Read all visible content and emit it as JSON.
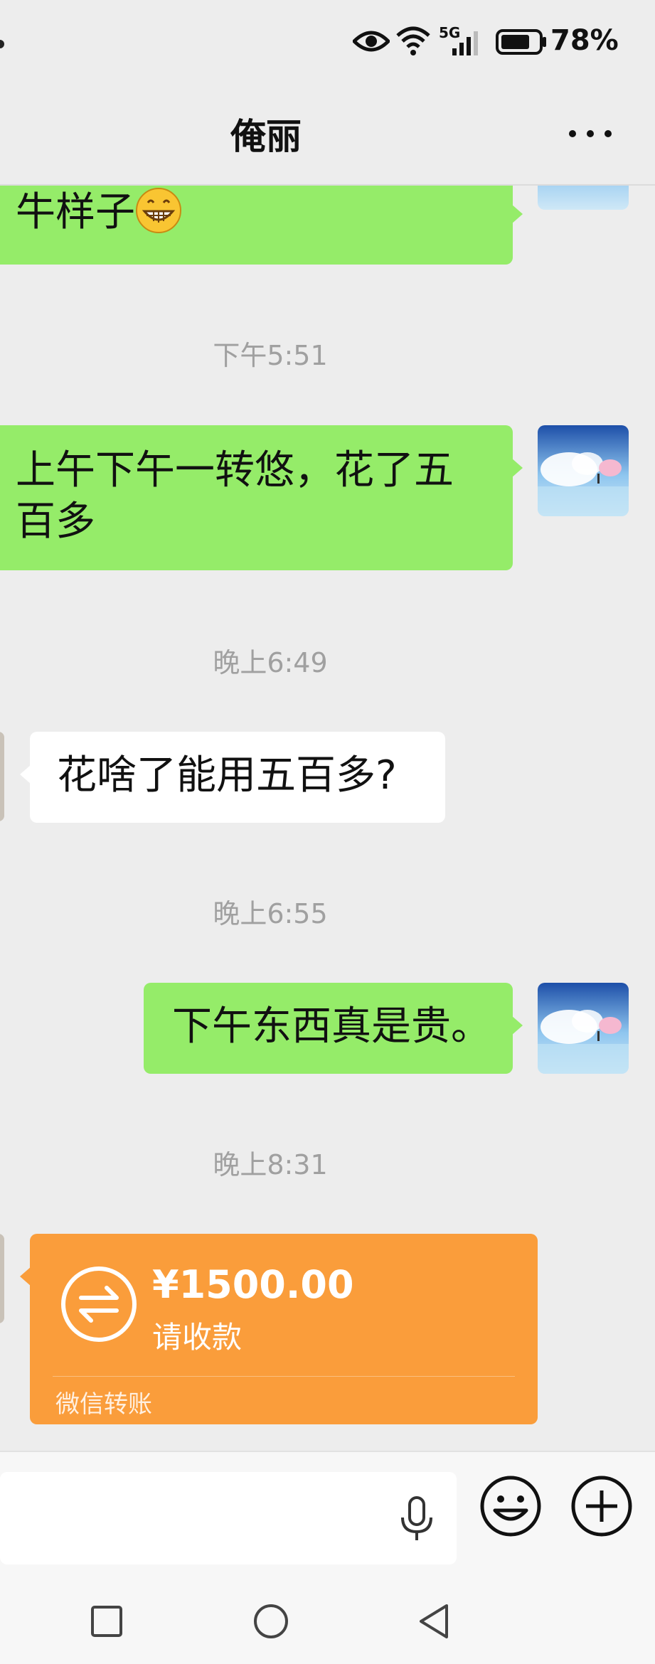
{
  "status_bar": {
    "network_label": "5G",
    "battery_level": 78,
    "battery_text": "78%"
  },
  "header": {
    "title": "俺丽"
  },
  "messages": [
    {
      "side": "sent",
      "text": "牛样子",
      "emoji": "grinning-face-icon"
    },
    {
      "type": "timestamp",
      "text": "下午5:51"
    },
    {
      "side": "sent",
      "line1": "上午下午一转悠，花了五",
      "line2": "百多"
    },
    {
      "type": "timestamp",
      "text": "晚上6:49"
    },
    {
      "side": "received",
      "text": "花啥了能用五百多?"
    },
    {
      "type": "timestamp",
      "text": "晚上6:55"
    },
    {
      "side": "sent",
      "text": "下午东西真是贵。"
    },
    {
      "type": "timestamp",
      "text": "晚上8:31"
    }
  ],
  "transfer": {
    "amount": "¥1500.00",
    "status": "请收款",
    "label": "微信转账",
    "icon": "transfer-arrows-icon"
  },
  "input_bar": {
    "icons": [
      "voice-icon",
      "emoji-icon",
      "plus-icon"
    ]
  },
  "nav_bar": {
    "icons": [
      "recents-icon",
      "home-icon",
      "back-icon"
    ]
  },
  "colors": {
    "background": "#ededed",
    "sent_bubble": "#95ec69",
    "received_bubble": "#ffffff",
    "transfer_card": "#fa9d3b",
    "timestamp": "#a0a0a0"
  }
}
